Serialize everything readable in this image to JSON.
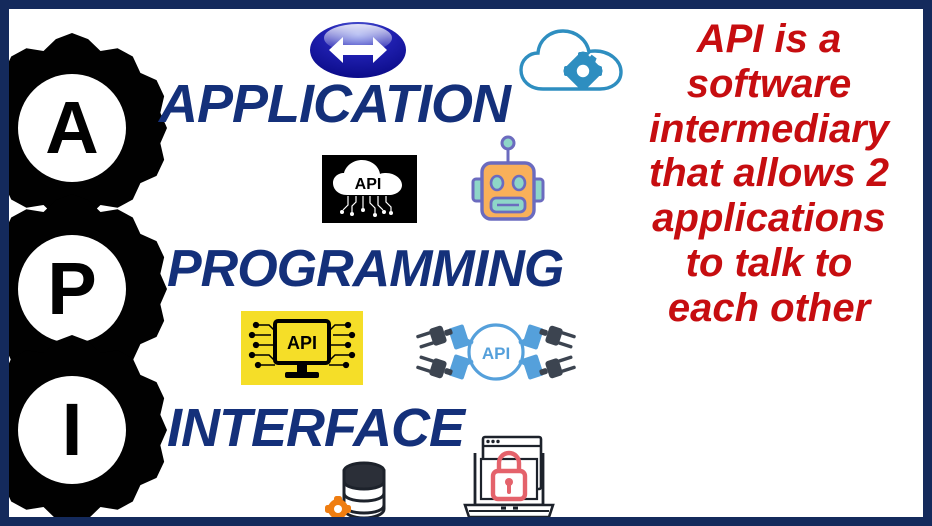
{
  "poster": {
    "border_color": "#142a5c",
    "background_color": "#ffffff",
    "word_color": "#14307a",
    "description_color": "#c60d10",
    "gear_color": "#010101"
  },
  "acronym": [
    {
      "letter": "A",
      "word": "APPLICATION"
    },
    {
      "letter": "P",
      "word": "PROGRAMMING"
    },
    {
      "letter": "I",
      "word": "INTERFACE"
    }
  ],
  "description": {
    "lines": [
      "API is a",
      "software",
      "intermediary",
      "that allows 2",
      "applications",
      "to talk to",
      "each other"
    ],
    "full_text": "API is a software intermediary that allows 2 applications to talk to each other"
  },
  "icons": {
    "double_arrow": {
      "name": "double-arrow-icon",
      "color": "#1414c8"
    },
    "cloud_gear": {
      "name": "cloud-gear-icon",
      "color": "#2e8ec0"
    },
    "api_cloud": {
      "name": "api-cloud-icon",
      "label": "API",
      "background": "#000000"
    },
    "robot": {
      "name": "robot-icon",
      "body_color": "#f9b05a",
      "outline_color": "#6b6bbf"
    },
    "api_monitor": {
      "name": "api-monitor-icon",
      "label": "API",
      "background": "#f5de28"
    },
    "api_plugs": {
      "name": "api-plugs-icon",
      "label": "API",
      "color": "#55a0db"
    },
    "database_gear": {
      "name": "database-gear-icon",
      "gear_color": "#ef7d10"
    },
    "laptop_lock": {
      "name": "laptop-lock-icon",
      "lock_color": "#e4626b"
    }
  }
}
